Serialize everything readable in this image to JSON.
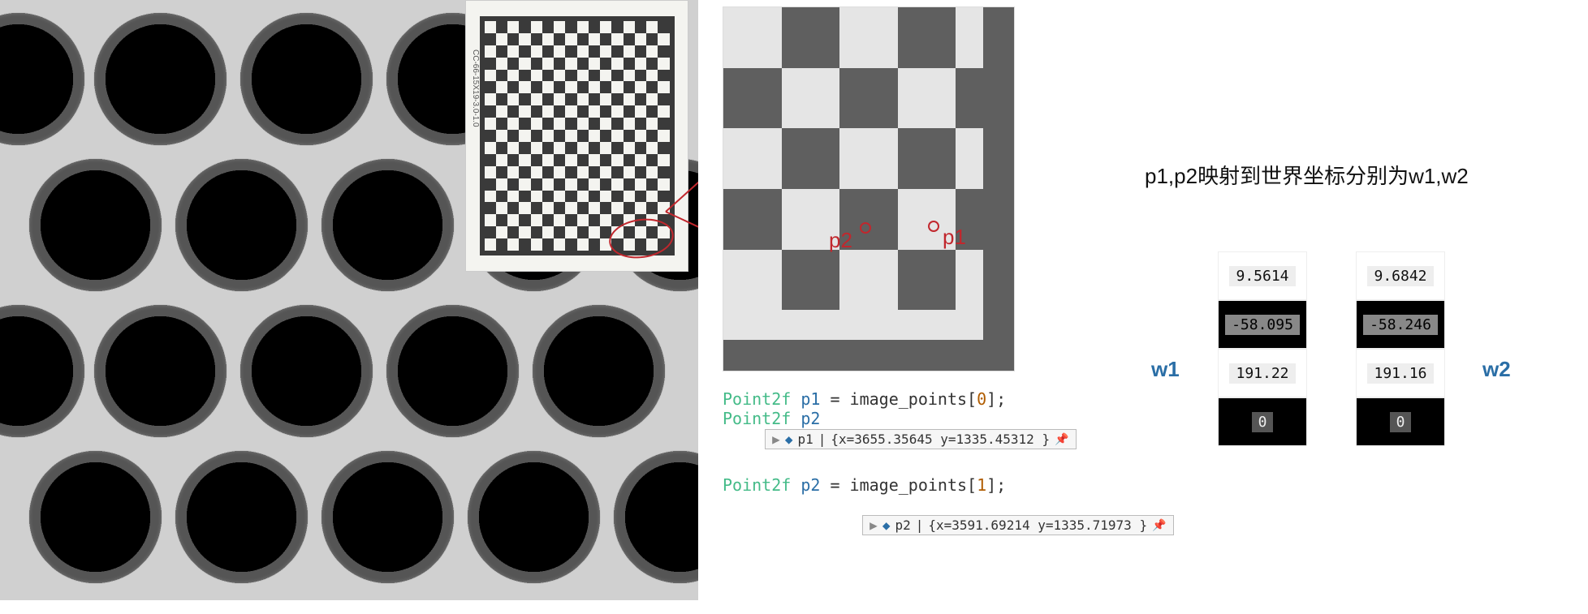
{
  "left": {
    "card_label": "CC-66-15X19-3.0-1.0"
  },
  "zoom": {
    "p1_label": "p1",
    "p2_label": "p2"
  },
  "code": {
    "line1_type": "Point2f",
    "line1_ident": "p1",
    "line1_rest": " = image_points[",
    "line1_idx": "0",
    "line1_end": "];",
    "line2_type": "Point2f",
    "line2_ident": "p2",
    "line3_type": "Point2f",
    "line3_ident": "p2",
    "line3_rest": " = image_points[",
    "line3_idx": "1",
    "line3_end": "];",
    "tip1_name": "p1",
    "tip1_value": "{x=3655.35645 y=1335.45312 }",
    "tip2_name": "p2",
    "tip2_value": "{x=3591.69214 y=1335.71973 }"
  },
  "right": {
    "caption": "p1,p2映射到世界坐标分别为w1,w2",
    "w1_label": "w1",
    "w2_label": "w2",
    "w1": [
      "9.5614",
      "-58.095",
      "191.22",
      "0"
    ],
    "w2": [
      "9.6842",
      "-58.246",
      "191.16",
      "0"
    ]
  },
  "chart_data": {
    "type": "table",
    "title": "Image points p1,p2 and their world-coordinate mappings w1,w2",
    "image_points": [
      {
        "name": "p1",
        "x": 3655.35645,
        "y": 1335.45312
      },
      {
        "name": "p2",
        "x": 3591.69214,
        "y": 1335.71973
      }
    ],
    "world_points": [
      {
        "name": "w1",
        "vector": [
          9.5614,
          -58.095,
          191.22,
          0
        ]
      },
      {
        "name": "w2",
        "vector": [
          9.6842,
          -58.246,
          191.16,
          0
        ]
      }
    ]
  }
}
